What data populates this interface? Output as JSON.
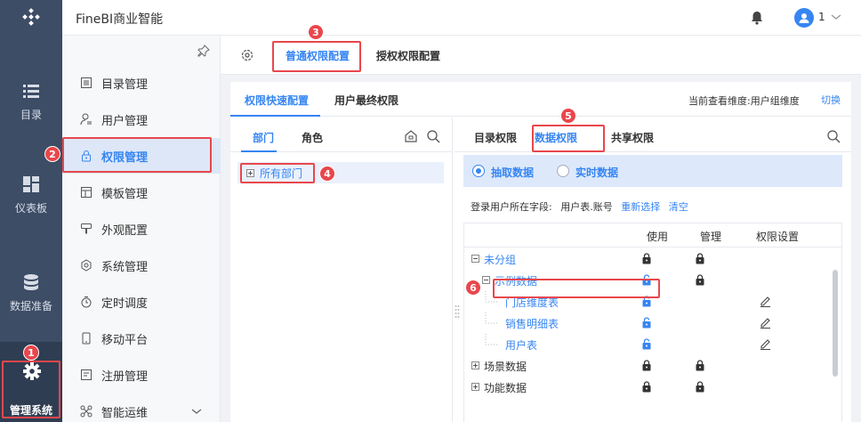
{
  "app": {
    "title": "FineBI商业智能",
    "user_name": "1"
  },
  "left_nav": [
    {
      "label": "目录",
      "icon": "list-icon"
    },
    {
      "label": "仪表板",
      "icon": "dashboard-icon"
    },
    {
      "label": "数据准备",
      "icon": "database-icon"
    },
    {
      "label": "管理系统",
      "icon": "gear-icon",
      "active": true
    }
  ],
  "sub_nav": [
    {
      "label": "目录管理"
    },
    {
      "label": "用户管理"
    },
    {
      "label": "权限管理",
      "active": true
    },
    {
      "label": "模板管理"
    },
    {
      "label": "外观配置"
    },
    {
      "label": "系统管理"
    },
    {
      "label": "定时调度"
    },
    {
      "label": "移动平台"
    },
    {
      "label": "注册管理"
    },
    {
      "label": "智能运维"
    }
  ],
  "top_tabs": [
    "普通权限配置",
    "授权权限配置"
  ],
  "sub_tabs": [
    "权限快速配置",
    "用户最终权限"
  ],
  "dimension": {
    "label": "当前查看维度:用户组维度",
    "switch": "切换"
  },
  "left_pane": {
    "tabs": [
      "部门",
      "角色"
    ],
    "tree_root": "所有部门"
  },
  "right_pane": {
    "tabs": [
      "目录权限",
      "数据权限",
      "共享权限"
    ],
    "modes": [
      "抽取数据",
      "实时数据"
    ],
    "login_label": "登录用户所在字段:",
    "login_value": "用户表.账号",
    "reselect": "重新选择",
    "clear": "清空",
    "columns": [
      "使用",
      "管理",
      "权限设置"
    ],
    "rows": [
      {
        "name": "未分组",
        "level": 0,
        "expand": "minus"
      },
      {
        "name": "示例数据",
        "level": 1,
        "expand": "minus"
      },
      {
        "name": "门店维度表",
        "level": 2
      },
      {
        "name": "销售明细表",
        "level": 2
      },
      {
        "name": "用户表",
        "level": 2
      },
      {
        "name": "场景数据",
        "level": 0,
        "expand": "plus"
      },
      {
        "name": "功能数据",
        "level": 0,
        "expand": "plus"
      }
    ]
  },
  "annotations": [
    "1",
    "2",
    "3",
    "4",
    "5",
    "6"
  ],
  "colors": {
    "accent": "#3685f2",
    "nav_bg": "#3d4d66",
    "annotation": "#e8474c"
  }
}
